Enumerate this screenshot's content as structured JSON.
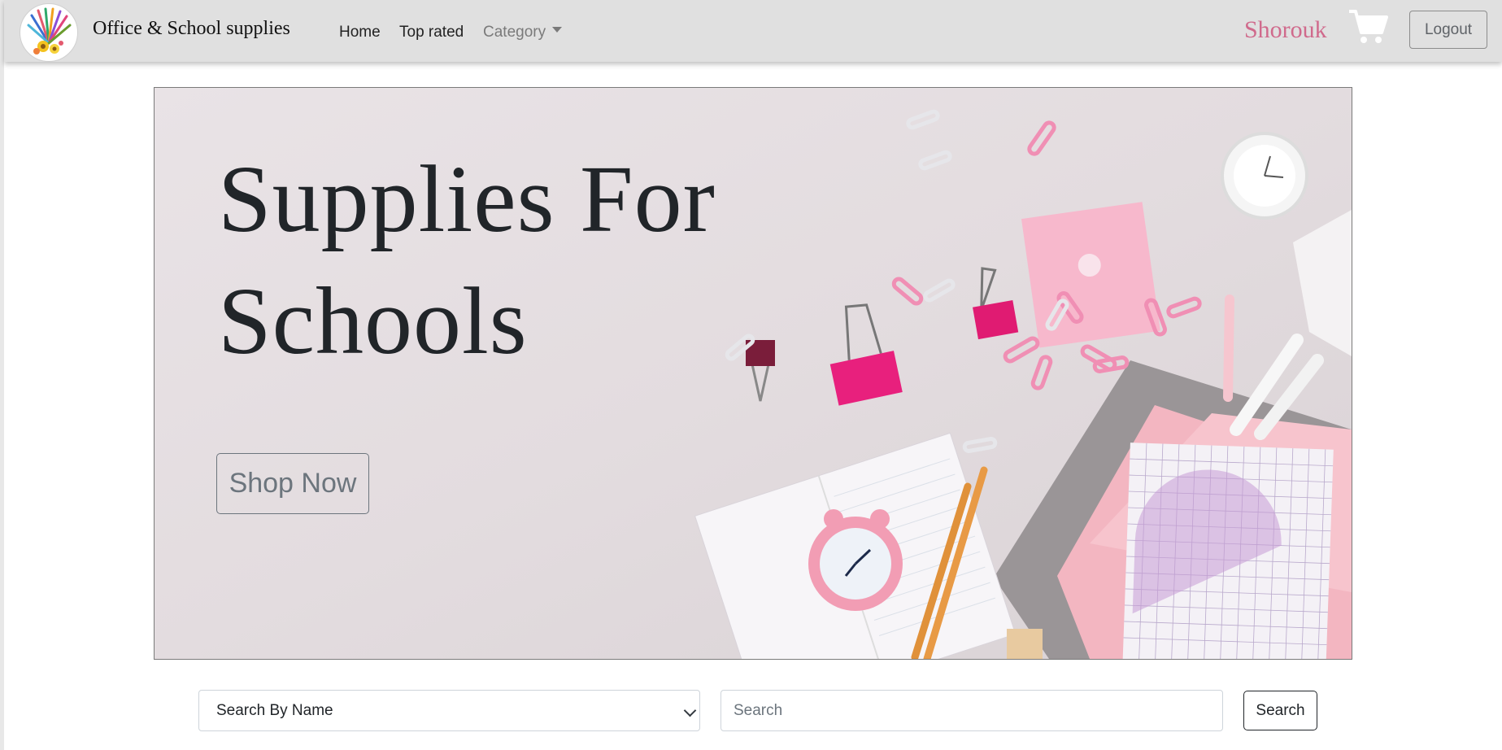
{
  "navbar": {
    "brand": "Office & School supplies",
    "links": {
      "home": "Home",
      "top_rated": "Top rated",
      "category": "Category"
    },
    "user_name": "Shorouk",
    "logout_label": "Logout",
    "colors": {
      "background": "#e0e0e0",
      "user_name": "#d06a8c"
    }
  },
  "hero": {
    "title": "Supplies For Schools",
    "button_label": "Shop Now"
  },
  "search": {
    "filter_selected": "Search By Name",
    "input_placeholder": "Search",
    "button_label": "Search"
  }
}
